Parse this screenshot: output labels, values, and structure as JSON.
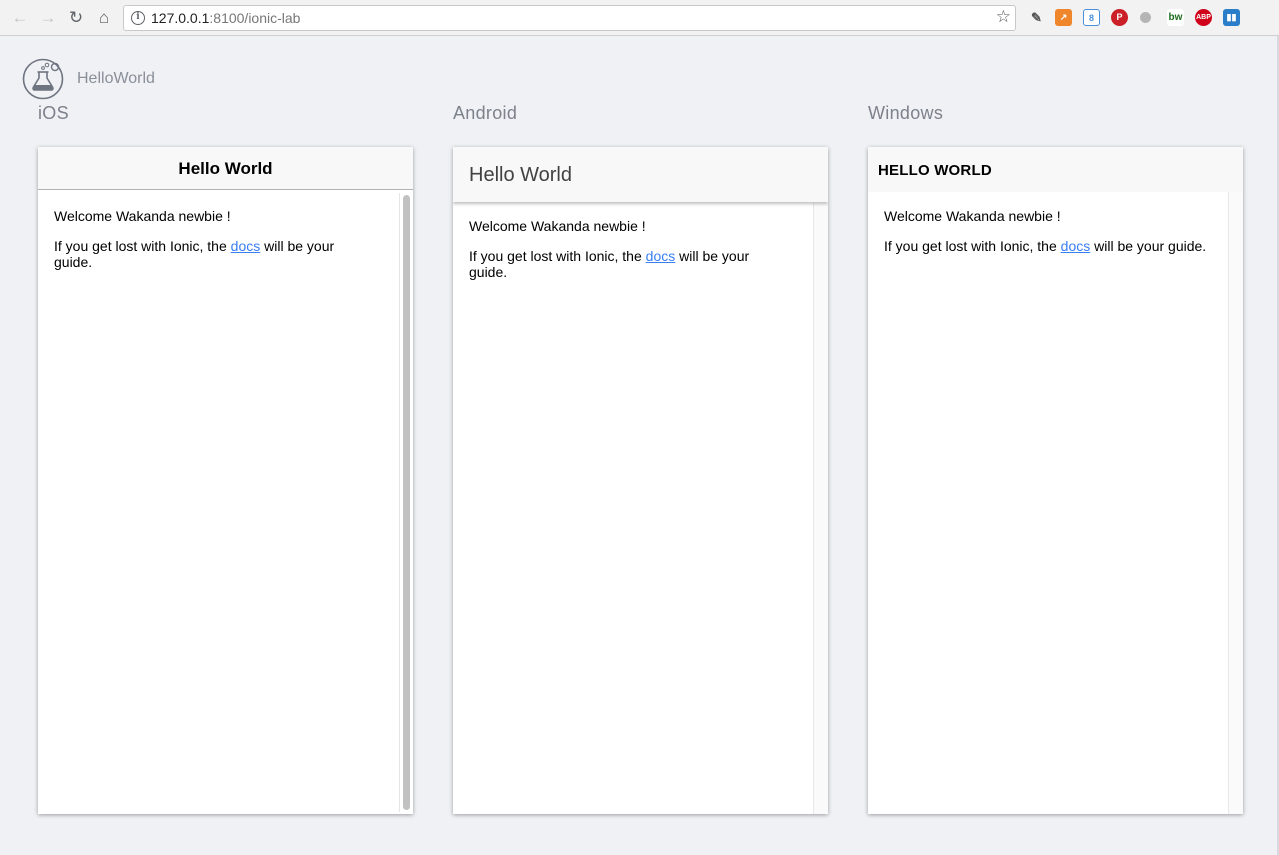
{
  "browser": {
    "url_host": "127.0.0.1",
    "url_rest": ":8100/ionic-lab",
    "icons": {
      "back": "back-arrow-icon",
      "forward": "forward-arrow-icon",
      "reload": "reload-icon",
      "home": "home-icon",
      "info": "i",
      "bookmark": "star-icon"
    },
    "extensions": [
      {
        "name": "edit-extension-icon",
        "label": "✎",
        "color": "#9aa0a6"
      },
      {
        "name": "chart-extension-icon",
        "label": "↗",
        "color": "#f0862c"
      },
      {
        "name": "blue-extension-icon",
        "label": "8",
        "color": "#4a90d9"
      },
      {
        "name": "pinterest-extension-icon",
        "label": "P",
        "color": "#cb2027"
      },
      {
        "name": "grey-dot-extension-icon",
        "label": "",
        "color": "#b5b5b5"
      },
      {
        "name": "bw-extension-icon",
        "label": "bw",
        "color": "#ffffff"
      },
      {
        "name": "adblock-extension-icon",
        "label": "ABP",
        "color": "#d0021b"
      },
      {
        "name": "trello-extension-icon",
        "label": "▮▮",
        "color": "#2a7dc9"
      }
    ]
  },
  "app": {
    "name": "HelloWorld"
  },
  "platforms": [
    {
      "label": "iOS",
      "title": "Hello World",
      "welcome": "Welcome Wakanda newbie !",
      "guide_before": "If you get lost with Ionic, the ",
      "guide_link": "docs",
      "guide_after": " will be your guide."
    },
    {
      "label": "Android",
      "title": "Hello World",
      "welcome": "Welcome Wakanda newbie !",
      "guide_before": "If you get lost with Ionic, the ",
      "guide_link": "docs",
      "guide_after": " will be your guide."
    },
    {
      "label": "Windows",
      "title": "HELLO WORLD",
      "welcome": "Welcome Wakanda newbie !",
      "guide_before": "If you get lost with Ionic, the ",
      "guide_link": "docs",
      "guide_after": " will be your guide."
    }
  ],
  "colors": {
    "page_bg": "#eff1f5",
    "link": "#387ef5",
    "label": "#7c818b"
  }
}
